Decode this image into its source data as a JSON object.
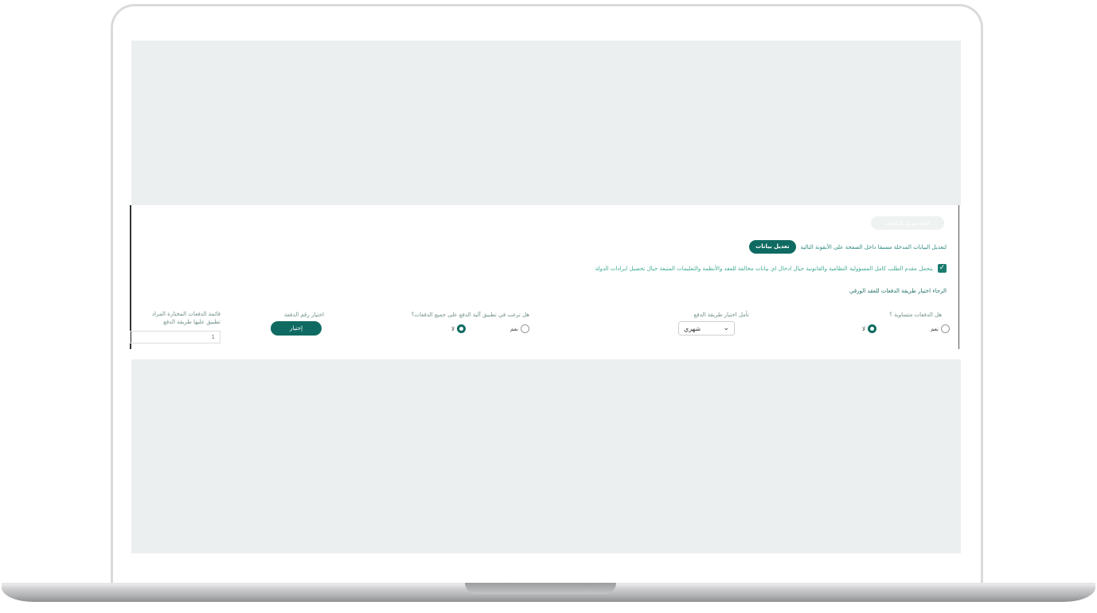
{
  "panel": {
    "ghost_button": "الغاء تعديل الدفعات",
    "edit_hint": "لتعديل البيانات المدخلة مسبقا داخل الصفحة على الأيقونة التالية",
    "edit_button": "تعديل بيانات",
    "declaration": "يتحمل مقدم الطلب كامل المسؤولية النظامية والقانونية حيال ادخال اي بيانات مخالفة للعقد والأنظمة والتعليمات المتبعة حيال تحصيل ايرادات الدولة",
    "instruction": "الرجاء اختيار طريقة الدفعات للعقد الورقي",
    "q_equal": "هل الدفعات متساوية ؟",
    "yes": "نعم",
    "no": "لا",
    "q_method": "نأمل اختيار طريقة الدفع",
    "method_value": "شهري",
    "q_apply_all": "هل ترغب في تطبيق آلية الدفع على جميع الدفعات؟",
    "q_choose_number": "اختيار رقم الدفعة",
    "choose_button": "إختيار",
    "list_label_1": "قائمة الدفعات المختارة المراد",
    "list_label_2": "تطبيق عليها طريقة الدفع",
    "list_value": "1"
  },
  "colors": {
    "accent": "#0f6b62",
    "screen_bg": "#eceff0"
  }
}
